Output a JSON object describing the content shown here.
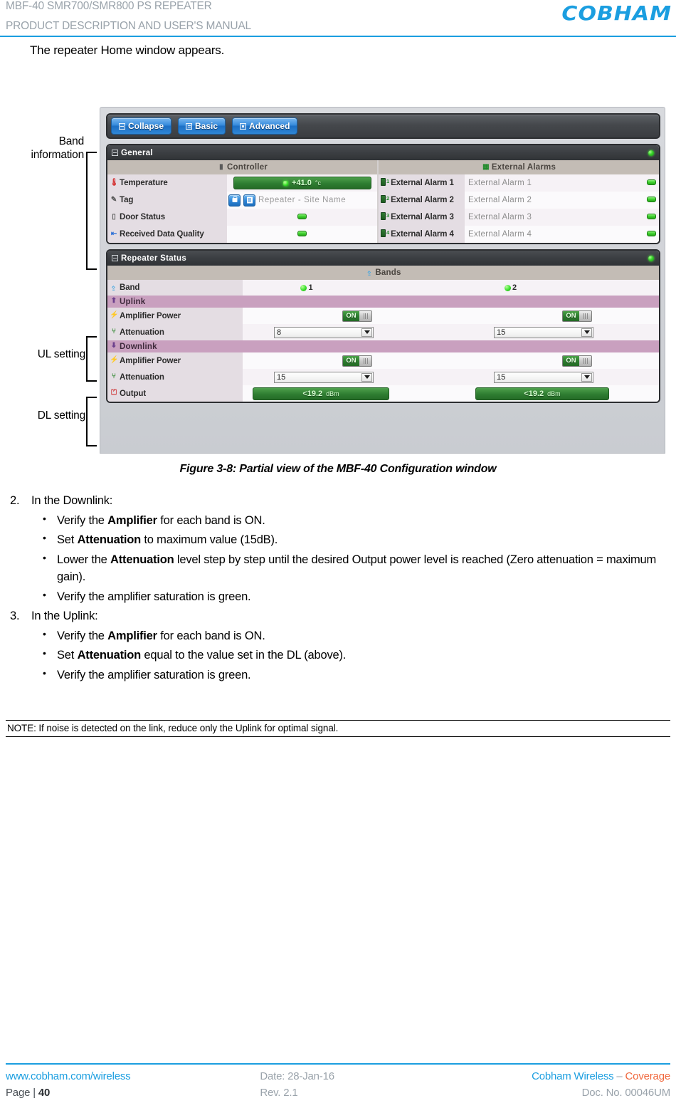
{
  "header": {
    "title_line1": "MBF-40 SMR700/SMR800 PS REPEATER",
    "title_line2": "PRODUCT DESCRIPTION AND USER'S MANUAL",
    "logo_text": "COBHAM",
    "accent_color": "#1b9ee0"
  },
  "intro": {
    "text": "The repeater Home window appears."
  },
  "annotations": {
    "band_information": "Band\ninformation",
    "band_information_line1": "Band",
    "band_information_line2": "information",
    "ul_setting": "UL setting",
    "dl_setting": "DL setting"
  },
  "app": {
    "toolbar": {
      "buttons": [
        {
          "label": "Collapse",
          "icon": "minus-box-icon"
        },
        {
          "label": "Basic",
          "icon": "document-icon"
        },
        {
          "label": "Advanced",
          "icon": "square-icon"
        }
      ]
    },
    "general_panel": {
      "title": "General",
      "status_led": "green",
      "columns": [
        "Controller",
        "External Alarms"
      ],
      "controller_rows": [
        {
          "label": "Temperature",
          "icon": "thermometer-icon",
          "value": "+41.0",
          "unit": "°c",
          "type": "green-bar"
        },
        {
          "label": "Tag",
          "icon": "pencil-icon",
          "value": "Repeater - Site Name",
          "type": "tag"
        },
        {
          "label": "Door Status",
          "icon": "door-icon",
          "value": "",
          "type": "pill"
        },
        {
          "label": "Received Data Quality",
          "icon": "signal-icon",
          "value": "",
          "type": "pill"
        }
      ],
      "alarm_rows": [
        {
          "label": "External Alarm 1",
          "num": "1",
          "name": "External Alarm 1"
        },
        {
          "label": "External Alarm 2",
          "num": "2",
          "name": "External Alarm 2"
        },
        {
          "label": "External Alarm 3",
          "num": "3",
          "name": "External Alarm 3"
        },
        {
          "label": "External Alarm 4",
          "num": "4",
          "name": "External Alarm 4"
        }
      ]
    },
    "repeater_status_panel": {
      "title": "Repeater Status",
      "status_led": "green",
      "bands_header": "Bands",
      "band_row_label": "Band",
      "bands": [
        "1",
        "2"
      ],
      "uplink": {
        "section_label": "Uplink",
        "amplifier_label": "Amplifier Power",
        "amplifier_values": [
          "ON",
          "ON"
        ],
        "attenuation_label": "Attenuation",
        "attenuation_values": [
          "8",
          "15"
        ]
      },
      "downlink": {
        "section_label": "Downlink",
        "amplifier_label": "Amplifier Power",
        "amplifier_values": [
          "ON",
          "ON"
        ],
        "attenuation_label": "Attenuation",
        "attenuation_values": [
          "15",
          "15"
        ],
        "output_label": "Output",
        "output_values": [
          "<19.2",
          "<19.2"
        ],
        "output_unit": "dBm"
      }
    }
  },
  "figure_caption": "Figure 3-8: Partial view of the MBF-40 Configuration window",
  "steps": [
    {
      "num": "2.",
      "title": "In the Downlink:",
      "bullets": [
        {
          "pre": "Verify the ",
          "bold": "Amplifier",
          "post": " for each band is ON."
        },
        {
          "pre": "Set ",
          "bold": "Attenuation",
          "post": " to maximum value (15dB)."
        },
        {
          "pre": "Lower the ",
          "bold": "Attenuation",
          "post": " level step by step until the desired Output power level is reached (Zero attenuation = maximum gain)."
        },
        {
          "pre": "Verify the amplifier saturation is green.",
          "bold": "",
          "post": ""
        }
      ]
    },
    {
      "num": "3.",
      "title": "In the Uplink:",
      "bullets": [
        {
          "pre": "Verify the ",
          "bold": "Amplifier",
          "post": " for each band is ON."
        },
        {
          "pre": "Set ",
          "bold": "Attenuation",
          "post": " equal to the value set in the DL (above)."
        },
        {
          "pre": "Verify the amplifier saturation is green.",
          "bold": "",
          "post": ""
        }
      ]
    }
  ],
  "note": "NOTE: If noise is detected on the link, reduce only the Uplink for optimal signal.",
  "footer": {
    "website": "www.cobham.com/wireless",
    "date": "Date: 28-Jan-16",
    "brand": "Cobham Wireless",
    "brand_sep": " – ",
    "brand_suffix": "Coverage",
    "page": "Page | ",
    "page_number": "40",
    "rev": "Rev. 2.1",
    "doc": "Doc. No. 00046UM"
  }
}
